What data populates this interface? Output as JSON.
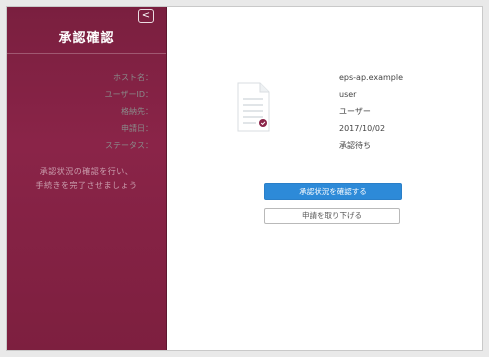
{
  "sidebar": {
    "title": "承認確認",
    "collapse_icon": "chevron-left-icon",
    "collapse_glyph": "<",
    "message_lines": [
      "承認状況の確認を行い、",
      "手続きを完了させましょう"
    ]
  },
  "info": {
    "host_label": "ホスト名：",
    "host_value": "eps-ap.example",
    "user_label": "ユーザーID：",
    "user_value": "user",
    "store_label": "格納先：",
    "store_value": "ユーザー",
    "date_label": "申請日：",
    "date_value": "2017/10/02",
    "status_label": "ステータス：",
    "status_value": "承認待ち"
  },
  "actions": {
    "check_label": "承認状況を確認する",
    "withdraw_label": "申請を取り下げる"
  },
  "colors": {
    "sidebar": "#7a1f3f",
    "primary": "#2d8ad8",
    "status_dot": "#8a2448"
  },
  "document_icon": "document-pending-icon"
}
